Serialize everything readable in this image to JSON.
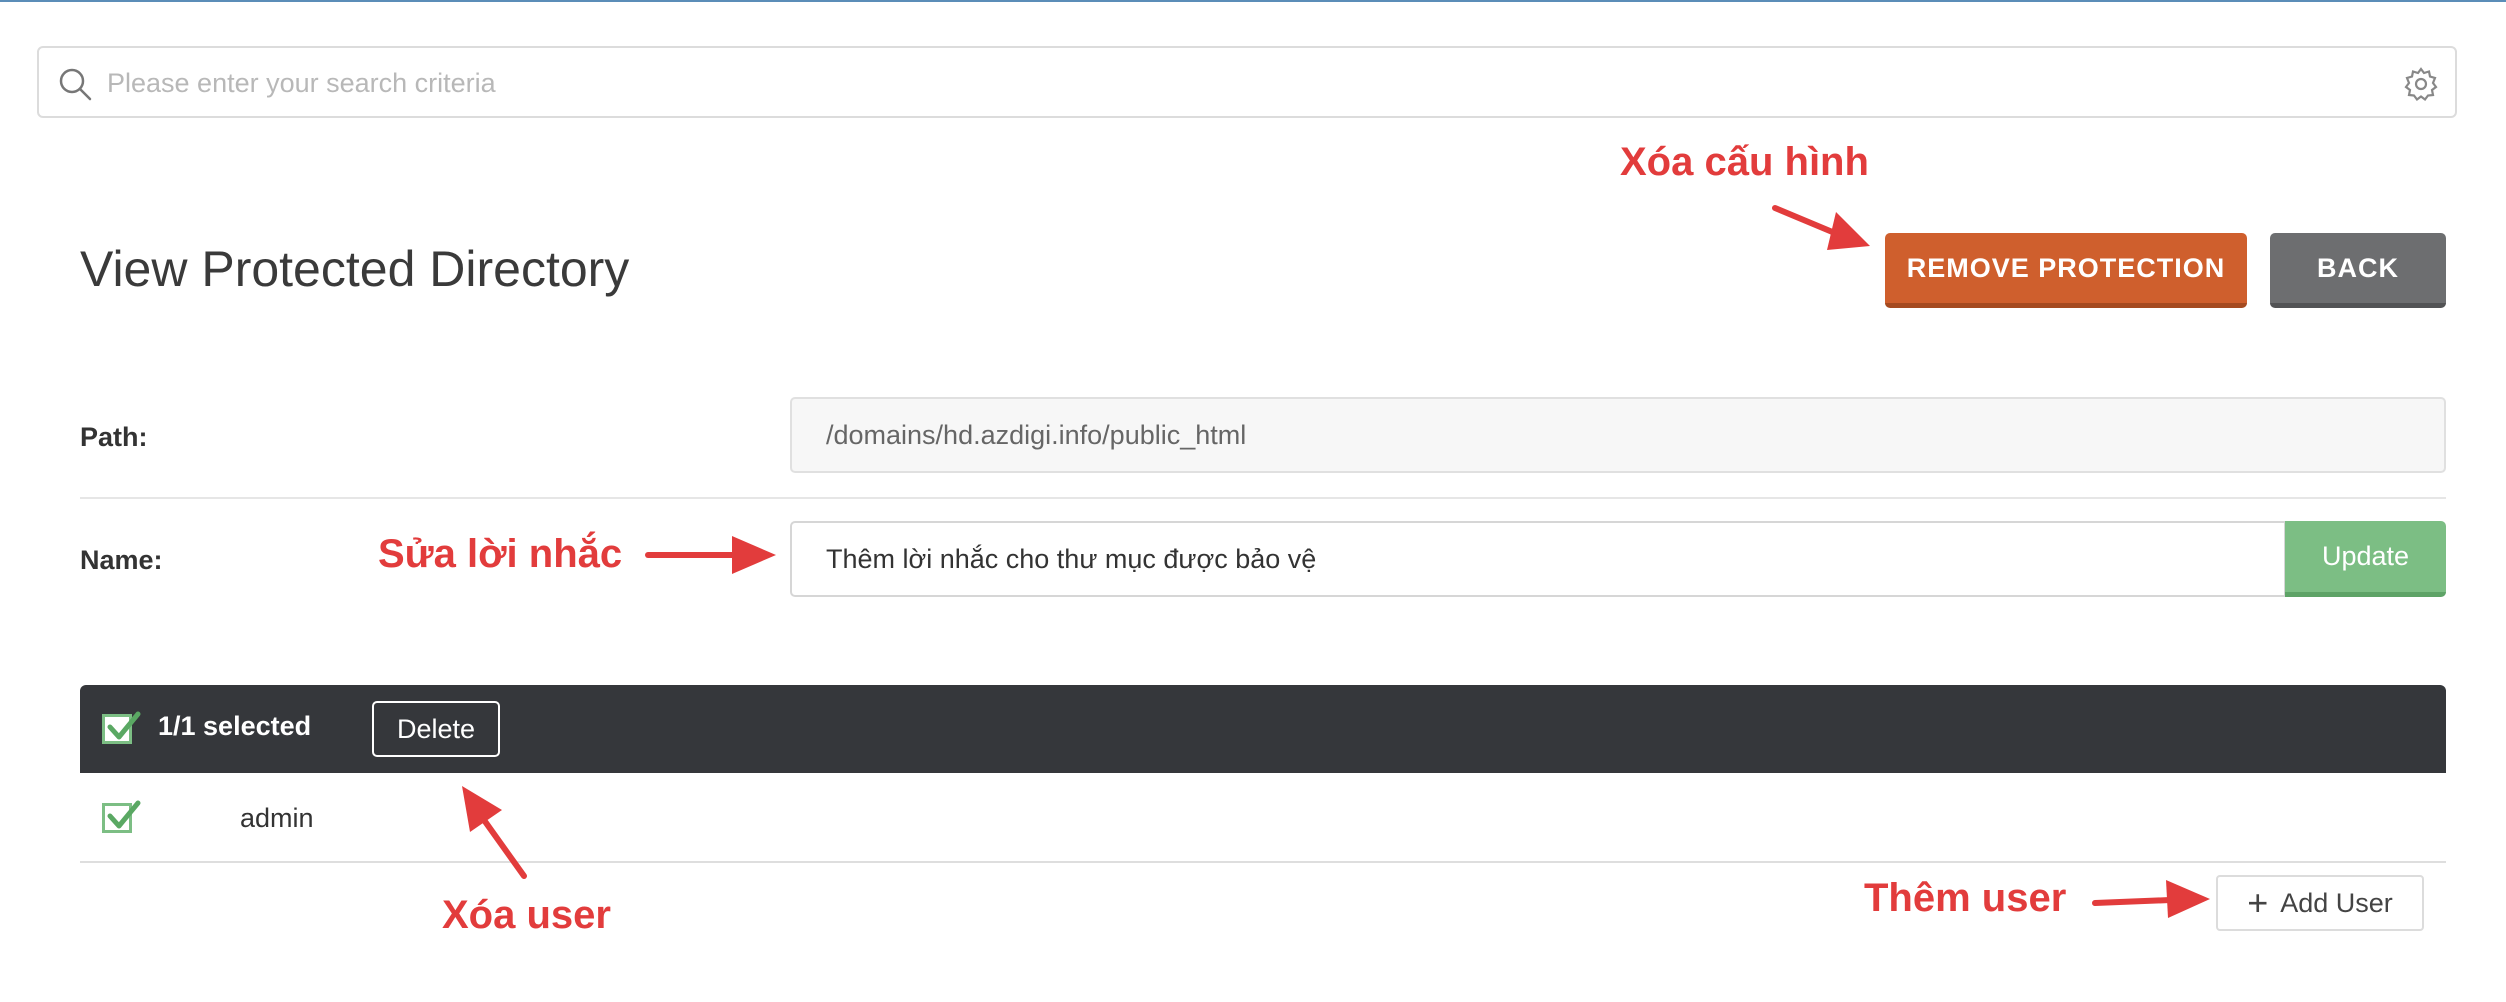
{
  "search": {
    "placeholder": "Please enter your search criteria",
    "value": ""
  },
  "page": {
    "title": "View Protected Directory"
  },
  "header_actions": {
    "remove_label": "REMOVE PROTECTION",
    "back_label": "BACK"
  },
  "form": {
    "path_label": "Path:",
    "path_value": "/domains/hd.azdigi.info/public_html",
    "name_label": "Name:",
    "name_value": "Thêm lời nhắc cho thư mục được bảo vệ",
    "update_label": "Update"
  },
  "users_table": {
    "selected_text": "1/1 selected",
    "delete_label": "Delete",
    "rows": [
      {
        "username": "admin",
        "checked": true
      }
    ],
    "add_user_label": "Add User"
  },
  "annotations": {
    "remove_config": "Xóa cấu hình",
    "edit_prompt": "Sửa lời nhắc",
    "delete_user": "Xóa user",
    "add_user": "Thêm user"
  },
  "colors": {
    "remove_button": "#cf5f2d",
    "back_button": "#6d6e70",
    "update_button": "#7cbe84",
    "table_header": "#35373b",
    "annotation": "#e23c3c",
    "checkbox": "#7cbe84"
  },
  "icons": {
    "search": "search-icon",
    "settings": "gear-icon",
    "add": "plus-icon",
    "checkbox": "checkmark-icon"
  }
}
